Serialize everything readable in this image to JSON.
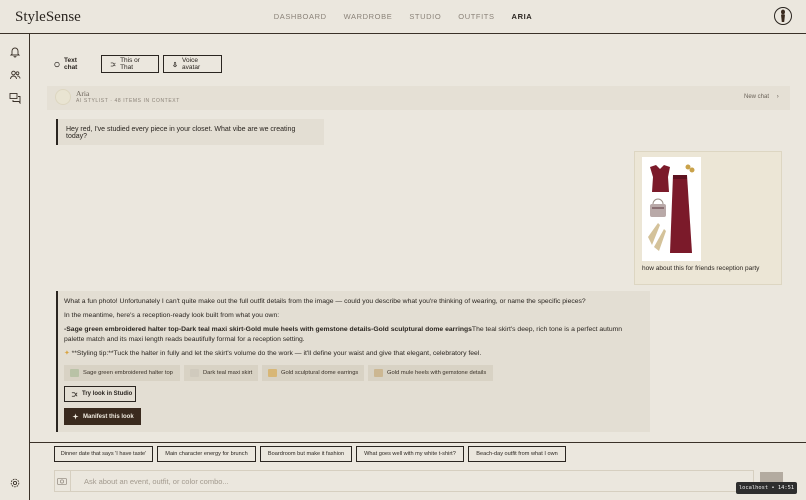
{
  "brand": "StyleSense",
  "nav": [
    {
      "label": "DASHBOARD",
      "active": false
    },
    {
      "label": "WARDROBE",
      "active": false
    },
    {
      "label": "STUDIO",
      "active": false
    },
    {
      "label": "OUTFITS",
      "active": false
    },
    {
      "label": "ARIA",
      "active": true
    }
  ],
  "rail_icons": [
    "bell-icon",
    "users-icon",
    "chat-icon",
    "gear-icon"
  ],
  "modes": [
    {
      "label": "Text chat",
      "active": true,
      "icon": "chat-bubble-icon"
    },
    {
      "label": "This or That",
      "active": false,
      "icon": "shuffle-icon"
    },
    {
      "label": "Voice avatar",
      "active": false,
      "icon": "mic-icon"
    }
  ],
  "assistant": {
    "name": "Aria",
    "subtitle": "AI STYLIST · 48 ITEMS IN CONTEXT",
    "new_chat": "New chat"
  },
  "messages": {
    "greeting": "Hey red, I've studied every piece in your closet. What vibe are we creating today?",
    "user_caption": "how about this for friends reception party",
    "reply_p1": "What a fun photo! Unfortunately I can't quite make out the full outfit details from the image — could you describe what you're thinking of wearing, or name the specific pieces?",
    "reply_p2": "In the meantime, here's a reception-ready look built from what you own:",
    "reply_items_bold": "-Sage green embroidered halter top-Dark teal maxi skirt-Gold mule heels with gemstone details-Gold sculptural dome earrings",
    "reply_items_rest_1": "The teal skirt's deep, rich tone is a perfect autumn",
    "reply_items_rest_2": "palette match and its maxi length reads beautifully formal for a reception setting.",
    "reply_tip": "**Styling tip:**Tuck the halter in fully and let the skirt's volume do the work — it'll define your waist and give that elegant, celebratory feel."
  },
  "chips": [
    "Sage green embroidered halter top",
    "Dark teal maxi skirt",
    "Gold sculptural dome earrings",
    "Gold mule heels with gemstone details"
  ],
  "buttons": {
    "try_studio": "Try look in Studio",
    "manifest": "Manifest this look"
  },
  "suggestions": [
    "Dinner date that says 'I have taste'",
    "Main character energy for brunch",
    "Boardroom but make it fashion",
    "What goes well with my white t-shirt?",
    "Beach-day outfit from what I own"
  ],
  "composer": {
    "placeholder": "Ask about an event, outfit, or color combo..."
  },
  "toast": "localhost • 14:51",
  "colors": {
    "background": "#ebe7de",
    "ink": "#2a2520",
    "primary_button": "#3a2a1e",
    "outfit_red": "#7b1a2a"
  }
}
